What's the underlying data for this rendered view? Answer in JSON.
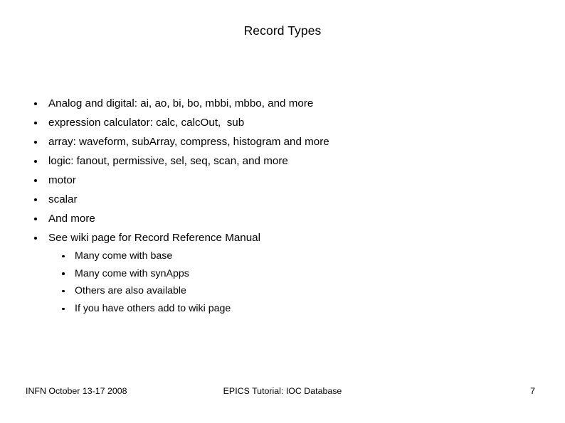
{
  "slide": {
    "title": "Record Types",
    "background_color": "#ffffff",
    "text_color": "#000000",
    "bullets": [
      {
        "level": 1,
        "text": "Analog and digital: ai, ao, bi, bo, mbbi, mbbo, and more"
      },
      {
        "level": 1,
        "text": "expression calculator: calc, calcOut,  sub"
      },
      {
        "level": 1,
        "text": "array: waveform, subArray, compress, histogram and more"
      },
      {
        "level": 1,
        "text": "logic: fanout, permissive, sel, seq, scan, and more"
      },
      {
        "level": 1,
        "text": "motor"
      },
      {
        "level": 1,
        "text": "scalar"
      },
      {
        "level": 1,
        "text": "And more"
      },
      {
        "level": 1,
        "text": "See wiki page for Record Reference Manual"
      },
      {
        "level": 2,
        "text": "Many come with base"
      },
      {
        "level": 2,
        "text": "Many come with synApps"
      },
      {
        "level": 2,
        "text": "Others are also available"
      },
      {
        "level": 2,
        "text": "If you have others add to wiki page"
      }
    ],
    "footer": {
      "left": "INFN October 13-17 2008",
      "center": "EPICS Tutorial: IOC Database",
      "page_number": "7"
    }
  }
}
